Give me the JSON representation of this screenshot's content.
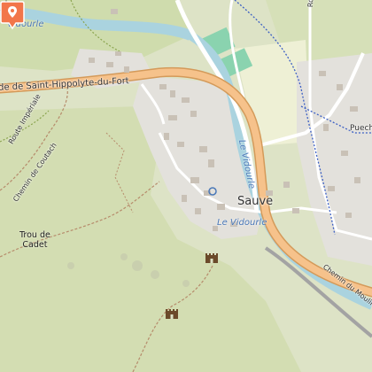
{
  "map": {
    "labels": {
      "road_saint_hippolyte": "de de Saint-Hippolyte-du-Fort",
      "route_imperiale": "Route Impériale",
      "chemin_couteach": "Chemin de Coutach",
      "vidourle_top": "Vidourle",
      "vidourle_vertical": "Le Vidourle",
      "vidourle_bottom": "Le Vidourle",
      "town": "Sauve",
      "trou_de_cadet_line1": "Trou de",
      "trou_de_cadet_line2": "Cadet",
      "route_top_right": "Route",
      "puech_partial": "Puech",
      "chemin_moulin": "Chemin du Moulin"
    },
    "icons": {
      "location_marker": "map-pin-icon",
      "castle_1": "castle-icon",
      "castle_2": "castle-icon",
      "cave": "cave-icon"
    },
    "colors": {
      "land": "#dde3c6",
      "forest": "#c9d9a8",
      "water": "#aad3df",
      "main_road": "#f6c28b",
      "road_casing": "#d49a5a",
      "residential": "#e0dfdf",
      "building": "#c9c1b6",
      "marker": "#f2764a",
      "sports": "#8ad3af",
      "field": "#eef0d5"
    }
  }
}
